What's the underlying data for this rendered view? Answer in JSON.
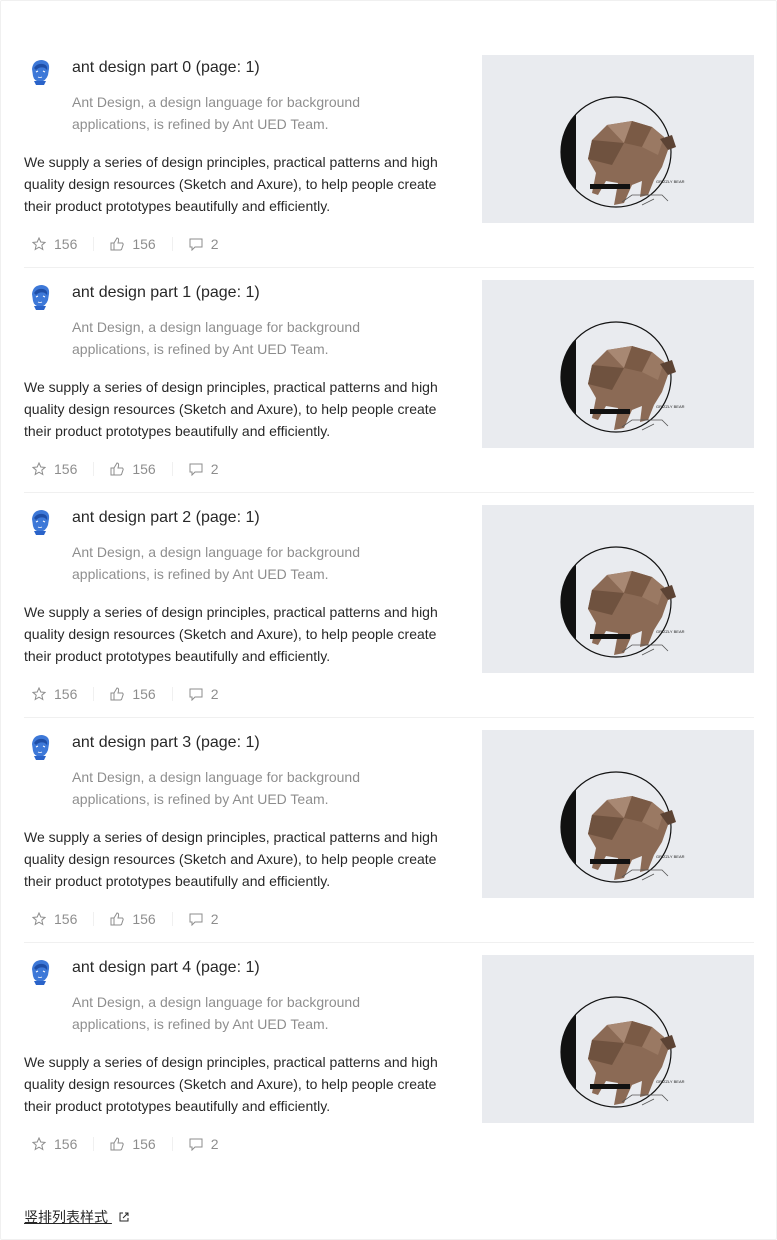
{
  "items": [
    {
      "title": "ant design part 0 (page: 1)",
      "description": "Ant Design, a design language for background applications, is refined by Ant UED Team.",
      "content": "We supply a series of design principles, practical patterns and high quality design resources (Sketch and Axure), to help people create their product prototypes beautifully and efficiently.",
      "stars": "156",
      "likes": "156",
      "messages": "2",
      "cover_caption": "GRIZZLY BEAR"
    },
    {
      "title": "ant design part 1 (page: 1)",
      "description": "Ant Design, a design language for background applications, is refined by Ant UED Team.",
      "content": "We supply a series of design principles, practical patterns and high quality design resources (Sketch and Axure), to help people create their product prototypes beautifully and efficiently.",
      "stars": "156",
      "likes": "156",
      "messages": "2",
      "cover_caption": "GRIZZLY BEAR"
    },
    {
      "title": "ant design part 2 (page: 1)",
      "description": "Ant Design, a design language for background applications, is refined by Ant UED Team.",
      "content": "We supply a series of design principles, practical patterns and high quality design resources (Sketch and Axure), to help people create their product prototypes beautifully and efficiently.",
      "stars": "156",
      "likes": "156",
      "messages": "2",
      "cover_caption": "GRIZZLY BEAR"
    },
    {
      "title": "ant design part 3 (page: 1)",
      "description": "Ant Design, a design language for background applications, is refined by Ant UED Team.",
      "content": "We supply a series of design principles, practical patterns and high quality design resources (Sketch and Axure), to help people create their product prototypes beautifully and efficiently.",
      "stars": "156",
      "likes": "156",
      "messages": "2",
      "cover_caption": "GRIZZLY BEAR"
    },
    {
      "title": "ant design part 4 (page: 1)",
      "description": "Ant Design, a design language for background applications, is refined by Ant UED Team.",
      "content": "We supply a series of design principles, practical patterns and high quality design resources (Sketch and Axure), to help people create their product prototypes beautifully and efficiently.",
      "stars": "156",
      "likes": "156",
      "messages": "2",
      "cover_caption": "GRIZZLY BEAR"
    }
  ],
  "icons": {
    "star": "star-icon",
    "like": "like-icon",
    "message": "message-icon",
    "external": "external-link-icon"
  },
  "footer": {
    "link_text": "竖排列表样式"
  },
  "colors": {
    "cover_bg": "#e9ebef",
    "bear_brown": "#8b6a55",
    "avatar_blue": "#2a63c9"
  }
}
